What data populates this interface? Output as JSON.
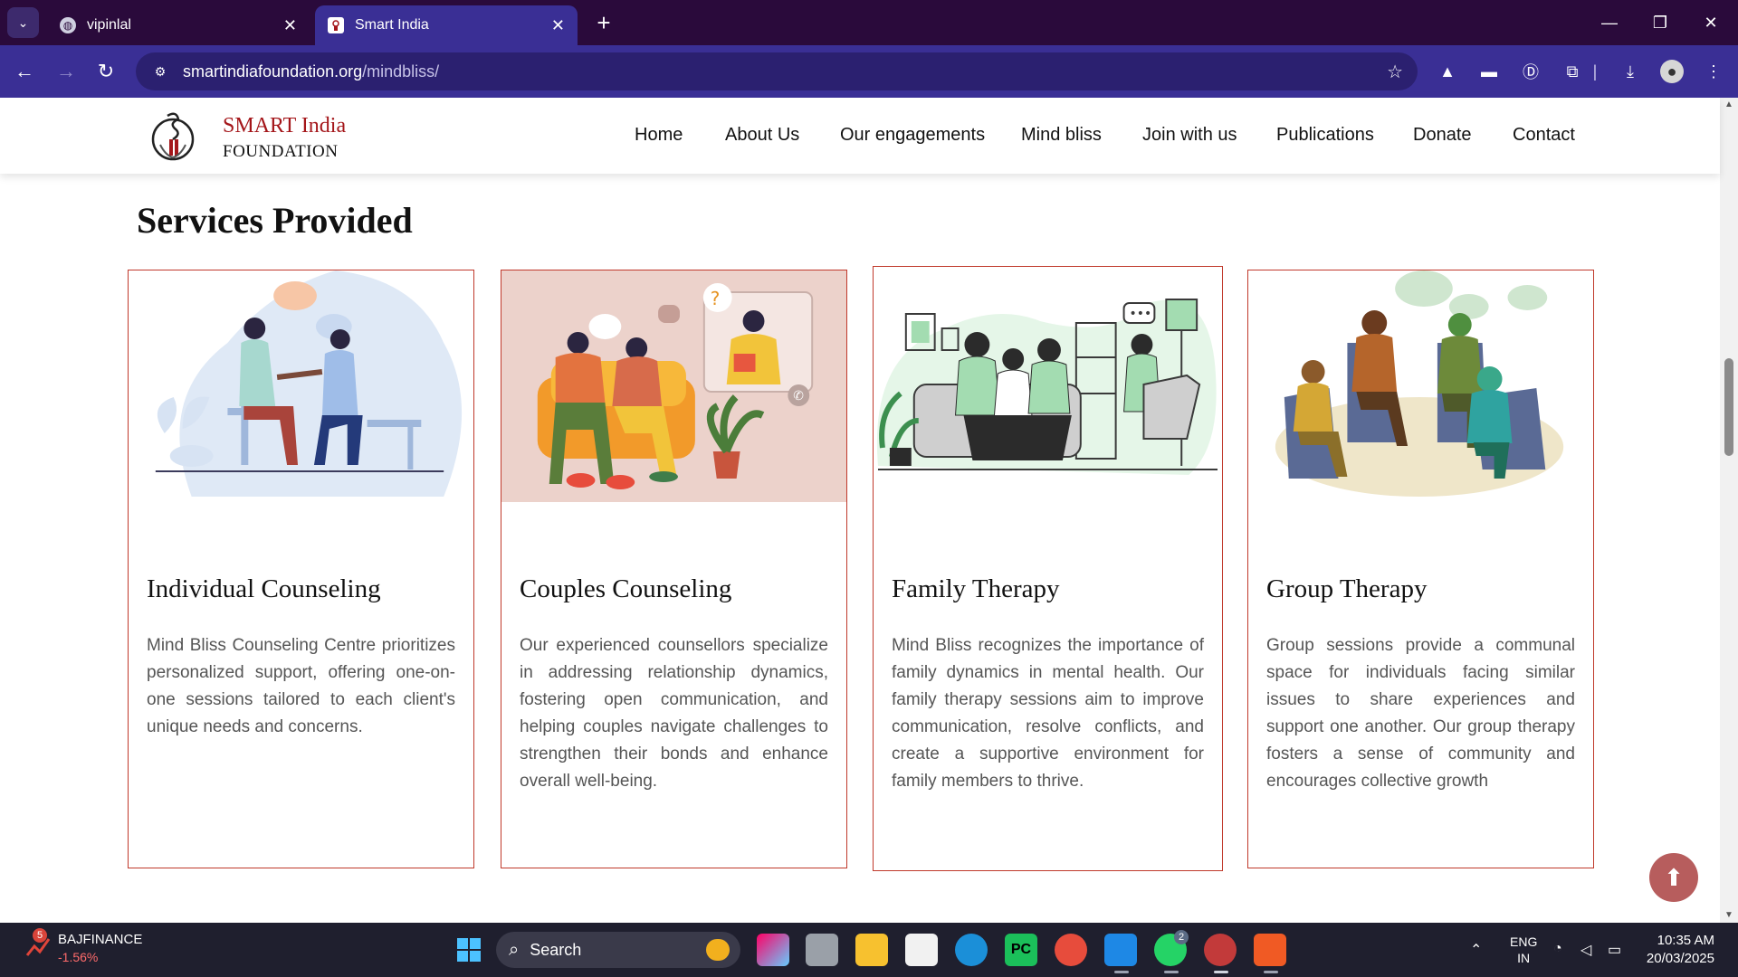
{
  "browser": {
    "tabs": [
      {
        "title": "vipinlal",
        "active": false
      },
      {
        "title": "Smart India",
        "active": true
      }
    ],
    "url_host": "smartindiafoundation.org",
    "url_path": "/mindbliss/"
  },
  "site": {
    "brand_line1": "SMART India",
    "brand_line2": "FOUNDATION",
    "nav": [
      "Home",
      "About Us",
      "Our engagements",
      "Mind bliss",
      "Join with us",
      "Publications",
      "Donate",
      "Contact"
    ],
    "section_title": "Services Provided",
    "cards": [
      {
        "title": "Individual Counseling",
        "body": "Mind Bliss Counseling Centre prioritizes personalized support, offering one-on-one sessions tailored to each client's unique needs and concerns."
      },
      {
        "title": "Couples Counseling",
        "body": "Our experienced counsellors specialize in addressing relationship dynamics, fostering open communication, and helping couples navigate challenges to strengthen their bonds and enhance overall well-being."
      },
      {
        "title": "Family Therapy",
        "body": "Mind Bliss recognizes the importance of family dynamics in mental health. Our family therapy sessions aim to improve communication, resolve conflicts, and create a supportive environment for family members to thrive."
      },
      {
        "title": "Group Therapy",
        "body": "Group sessions provide a communal space for individuals facing similar issues to share experiences and support one another. Our group therapy fosters a sense of community and encourages collective growth"
      }
    ]
  },
  "taskbar": {
    "stock_badge": "5",
    "stock_name": "BAJFINANCE",
    "stock_change": "-1.56%",
    "search_label": "Search",
    "whatsapp_badge": "2",
    "lang_line1": "ENG",
    "lang_line2": "IN",
    "time": "10:35 AM",
    "date": "20/03/2025"
  },
  "colors": {
    "tab_strip": "#2a0a3b",
    "toolbar": "#3a2f95",
    "brand_red": "#a4161a",
    "card_border": "#c0392b",
    "scroll_top_button": "#b75d5d"
  }
}
